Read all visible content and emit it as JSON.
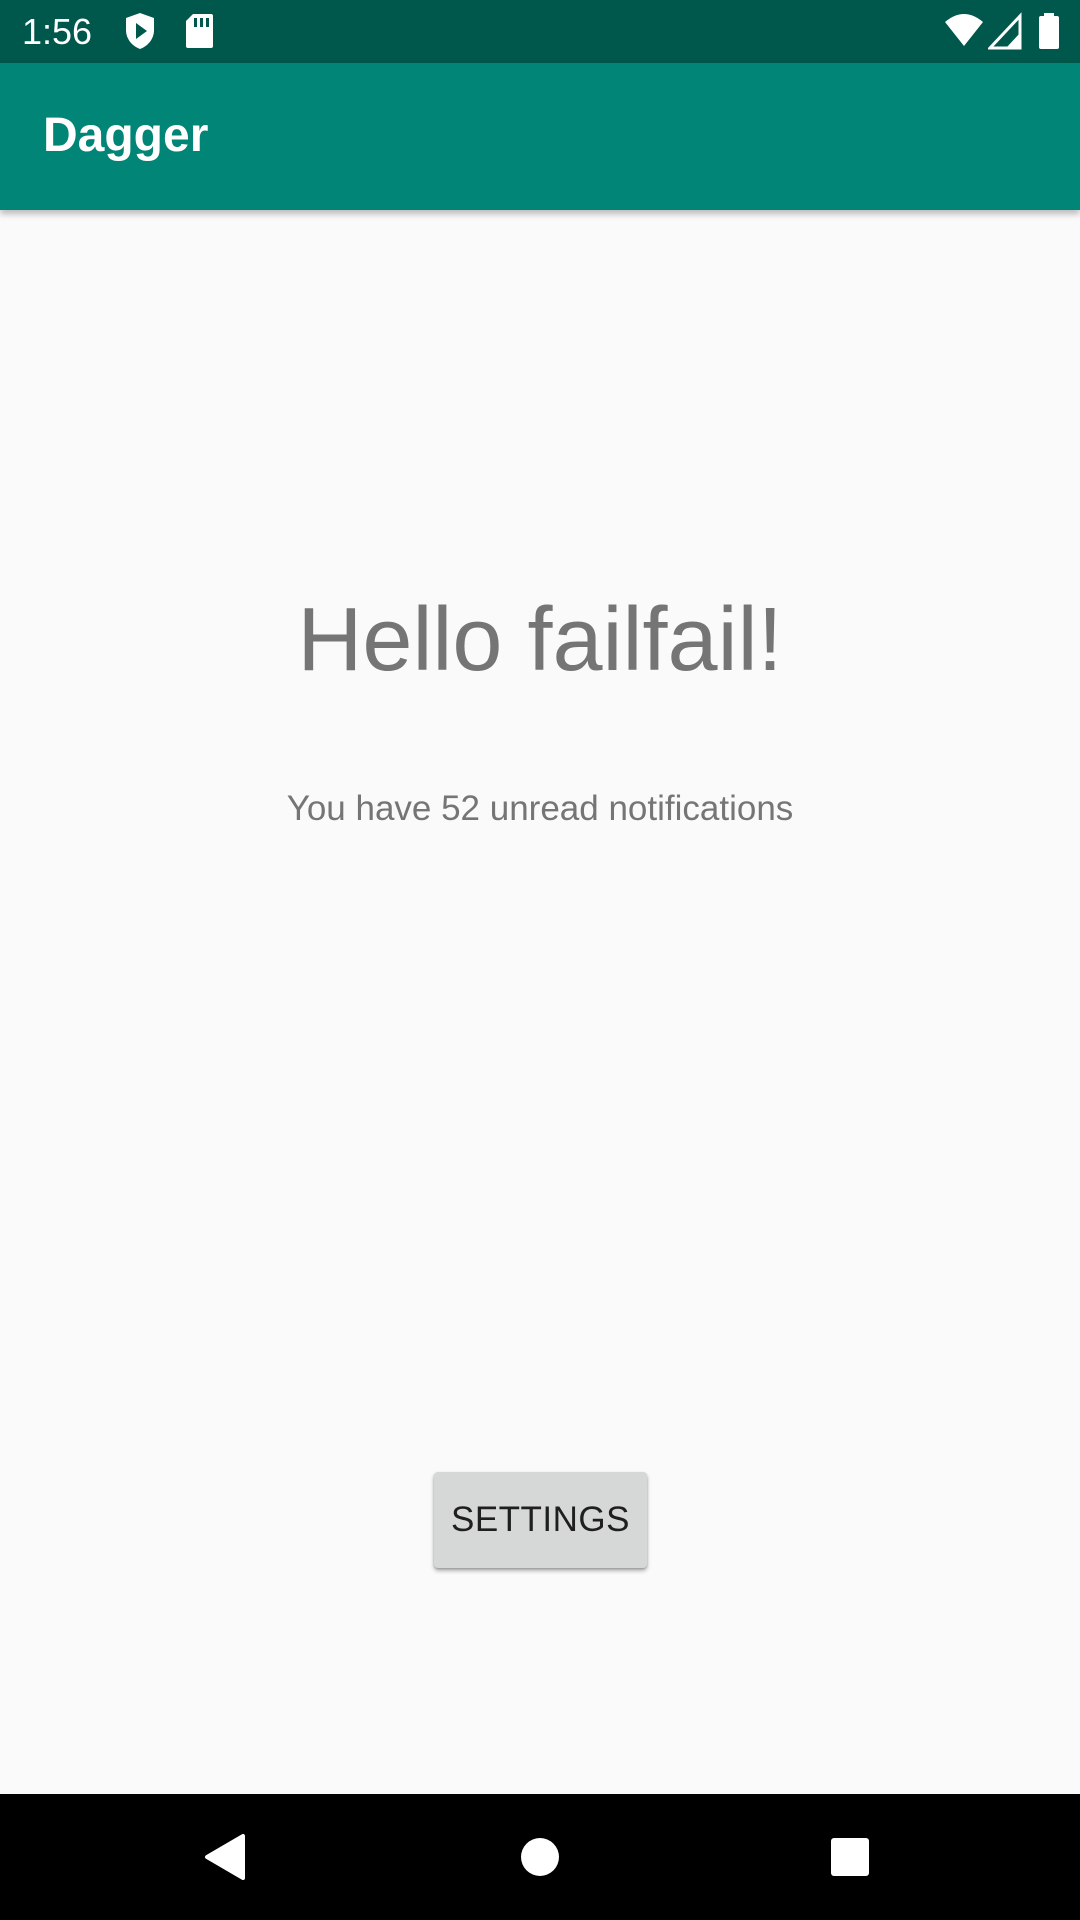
{
  "status_bar": {
    "time": "1:56",
    "icons_left": [
      "play-protect-icon",
      "sd-card-icon"
    ],
    "icons_right": [
      "wifi-icon",
      "cell-signal-icon",
      "battery-icon"
    ],
    "background": "#00574b"
  },
  "app_bar": {
    "title": "Dagger",
    "background": "#008577"
  },
  "main": {
    "greeting": "Hello failfail!",
    "notifications": "You have 52 unread notifications",
    "settings_label": "SETTINGS"
  },
  "nav_bar": {
    "buttons": [
      "back-icon",
      "home-icon",
      "recents-icon"
    ]
  }
}
